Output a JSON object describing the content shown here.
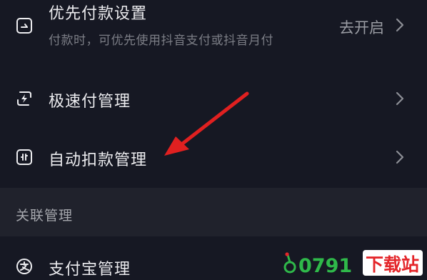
{
  "rows": [
    {
      "title": "优先付款设置",
      "subtitle": "付款时，可优先使用抖音支付或抖音月付",
      "value": "去开启",
      "icon": "priority-pay-icon"
    },
    {
      "title": "极速付管理",
      "icon": "lightning-pay-icon"
    },
    {
      "title": "自动扣款管理",
      "icon": "auto-debit-icon"
    }
  ],
  "section": {
    "title": "关联管理"
  },
  "linked_rows": [
    {
      "title": "支付宝管理",
      "icon": "alipay-icon"
    }
  ],
  "watermark": {
    "text": "0791",
    "suffix": "下载站"
  },
  "colors": {
    "background": "#161823",
    "section_background": "#20222c",
    "title_text": "#ececef",
    "secondary_text": "#7c7e86",
    "annotation_arrow": "#e02020",
    "watermark_green": "#2fb84a",
    "watermark_red": "#e4262a"
  }
}
